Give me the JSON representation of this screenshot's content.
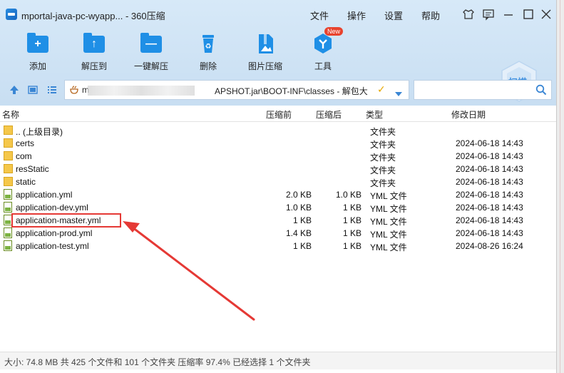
{
  "window": {
    "title": "mportal-java-pc-wyapp... - 360压缩",
    "menu": [
      "文件",
      "操作",
      "设置",
      "帮助"
    ]
  },
  "toolbar": {
    "items": [
      {
        "label": "添加",
        "icon": "add-icon"
      },
      {
        "label": "解压到",
        "icon": "extract-to-icon"
      },
      {
        "label": "一键解压",
        "icon": "one-click-extract-icon"
      },
      {
        "label": "删除",
        "icon": "recycle-bin-icon"
      },
      {
        "label": "图片压缩",
        "icon": "image-compress-icon"
      },
      {
        "label": "工具",
        "icon": "tools-icon"
      }
    ],
    "new_badge": "New",
    "scan_label": "扫描"
  },
  "address": {
    "prefix": "m",
    "path": "APSHOT.jar\\BOOT-INF\\classes - 解包大"
  },
  "columns": {
    "name": "名称",
    "before": "压缩前",
    "after": "压缩后",
    "type": "类型",
    "modified": "修改日期"
  },
  "files": [
    {
      "name": ".. (上级目录)",
      "before": "",
      "after": "",
      "type": "文件夹",
      "modified": "",
      "kind": "folder"
    },
    {
      "name": "certs",
      "before": "",
      "after": "",
      "type": "文件夹",
      "modified": "2024-06-18 14:43",
      "kind": "folder"
    },
    {
      "name": "com",
      "before": "",
      "after": "",
      "type": "文件夹",
      "modified": "2024-06-18 14:43",
      "kind": "folder"
    },
    {
      "name": "resStatic",
      "before": "",
      "after": "",
      "type": "文件夹",
      "modified": "2024-06-18 14:43",
      "kind": "folder"
    },
    {
      "name": "static",
      "before": "",
      "after": "",
      "type": "文件夹",
      "modified": "2024-06-18 14:43",
      "kind": "folder"
    },
    {
      "name": "application.yml",
      "before": "2.0 KB",
      "after": "1.0 KB",
      "type": "YML 文件",
      "modified": "2024-06-18 14:43",
      "kind": "file"
    },
    {
      "name": "application-dev.yml",
      "before": "1.0 KB",
      "after": "1 KB",
      "type": "YML 文件",
      "modified": "2024-06-18 14:43",
      "kind": "file"
    },
    {
      "name": "application-master.yml",
      "before": "1 KB",
      "after": "1 KB",
      "type": "YML 文件",
      "modified": "2024-06-18 14:43",
      "kind": "file"
    },
    {
      "name": "application-prod.yml",
      "before": "1.4 KB",
      "after": "1 KB",
      "type": "YML 文件",
      "modified": "2024-06-18 14:43",
      "kind": "file"
    },
    {
      "name": "application-test.yml",
      "before": "1 KB",
      "after": "1 KB",
      "type": "YML 文件",
      "modified": "2024-08-26 16:24",
      "kind": "file"
    }
  ],
  "status": "大小: 74.8 MB 共 425 个文件和 101 个文件夹 压缩率 97.4% 已经选择 1 个文件夹",
  "colors": {
    "accent": "#1f8fe6",
    "highlight": "#e53935",
    "header_bg": "#d3e6f7"
  }
}
